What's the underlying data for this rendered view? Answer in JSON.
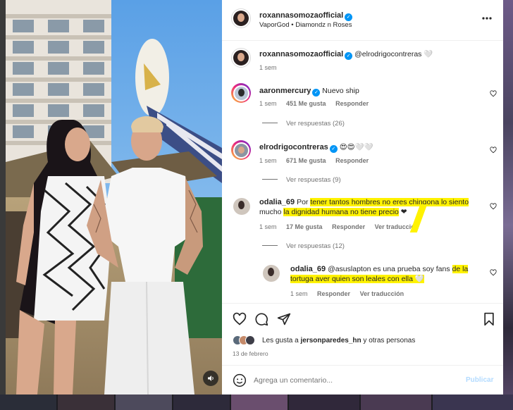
{
  "post": {
    "author": "roxannasomozaofficial",
    "audio": "VaporGod • Diamondz n Roses"
  },
  "caption": {
    "author": "roxannasomozaofficial",
    "text": "@elrodrigocontreras 🤍",
    "time": "1 sem"
  },
  "comments": [
    {
      "author": "aaronmercury",
      "verified": true,
      "text": "Nuevo ship",
      "time": "1 sem",
      "likes": "451 Me gusta",
      "reply": "Responder",
      "view_replies": "Ver respuestas (26)"
    },
    {
      "author": "elrodrigocontreras",
      "verified": true,
      "text": "😍😍🤍🤍",
      "time": "1 sem",
      "likes": "671 Me gusta",
      "reply": "Responder",
      "view_replies": "Ver respuestas (9)"
    },
    {
      "author": "odalia_69",
      "verified": false,
      "text_pre": "Por ",
      "text_hl1": "tener tantos hombres no eres chingona lo siento",
      "text_line2_pre": "mucho ",
      "text_hl2": "la dignidad humana no tiene precio",
      "text_post": " ❤",
      "time": "1 sem",
      "likes": "17 Me gusta",
      "reply": "Responder",
      "translate": "Ver traducción",
      "view_replies": "Ver respuestas (12)"
    }
  ],
  "reply": {
    "author": "odalia_69",
    "text_pre": "@asuslapton es una prueba soy fans ",
    "text_hl1": "de la",
    "text_hl2": "tortuga aver quien son leales con ella 🤍",
    "time": "1 sem",
    "reply": "Responder",
    "translate": "Ver traducción"
  },
  "likes_summary": {
    "prefix": "Les gusta a ",
    "user": "jersonparedes_hn",
    "suffix": " y otras personas"
  },
  "date": "13 de febrero",
  "comment_input": {
    "placeholder": "Agrega un comentario...",
    "publish": "Publicar"
  },
  "colors": {
    "highlight": "#fff200",
    "verified": "#0095f6",
    "muted": "#737373",
    "text": "#262626"
  },
  "icons": [
    "more-options-icon",
    "heart-icon",
    "comment-icon",
    "share-icon",
    "bookmark-icon",
    "emoji-icon",
    "audio-icon"
  ]
}
